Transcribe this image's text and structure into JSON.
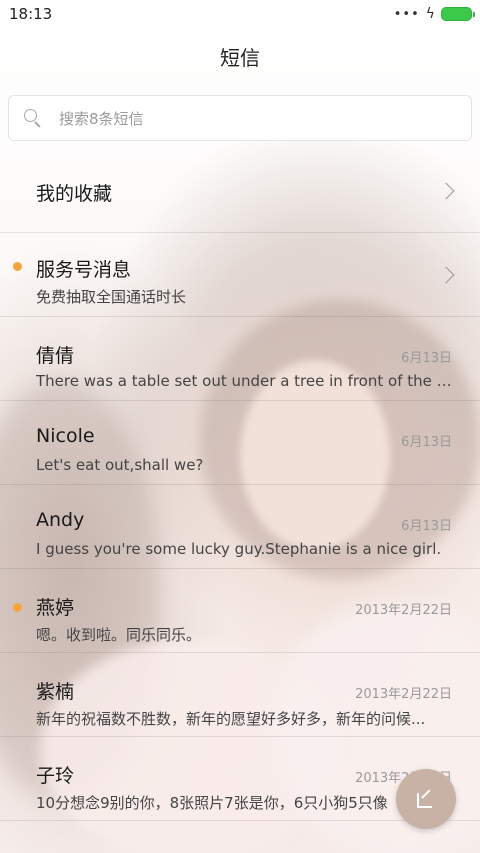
{
  "status_bar": {
    "time": "18:13",
    "signal_icon": "more-dots-icon",
    "charging_icon": "bolt-icon",
    "battery_color": "#3cc94a"
  },
  "header": {
    "title": "短信"
  },
  "search": {
    "placeholder": "搜索8条短信"
  },
  "favorites": {
    "label": "我的收藏"
  },
  "service": {
    "title": "服务号消息",
    "preview": "免费抽取全国通话时长",
    "unread": true
  },
  "conversations": [
    {
      "name": "倩倩",
      "preview": "There was a table set out under a tree in front of the ho...",
      "date": "6月13日",
      "unread": false
    },
    {
      "name": "Nicole",
      "preview": "Let's eat out,shall we?",
      "date": "6月13日",
      "unread": false
    },
    {
      "name": "Andy",
      "preview": "I guess you're some lucky guy.Stephanie is a nice girl.",
      "date": "6月13日",
      "unread": false
    },
    {
      "name": "燕婷",
      "preview": "嗯。收到啦。同乐同乐。",
      "date": "2013年2月22日",
      "unread": true
    },
    {
      "name": "紫楠",
      "preview": "新年的祝福数不胜数，新年的愿望好多好多，新年的问候...",
      "date": "2013年2月22日",
      "unread": false
    },
    {
      "name": "子玲",
      "preview": "10分想念9别的你，8张照片7张是你，6只小狗5只像",
      "date": "2013年2月22日",
      "unread": false
    }
  ],
  "fab": {
    "icon": "compose-icon",
    "color": "#c8b2a6"
  },
  "accent_color": "#f3a53b"
}
